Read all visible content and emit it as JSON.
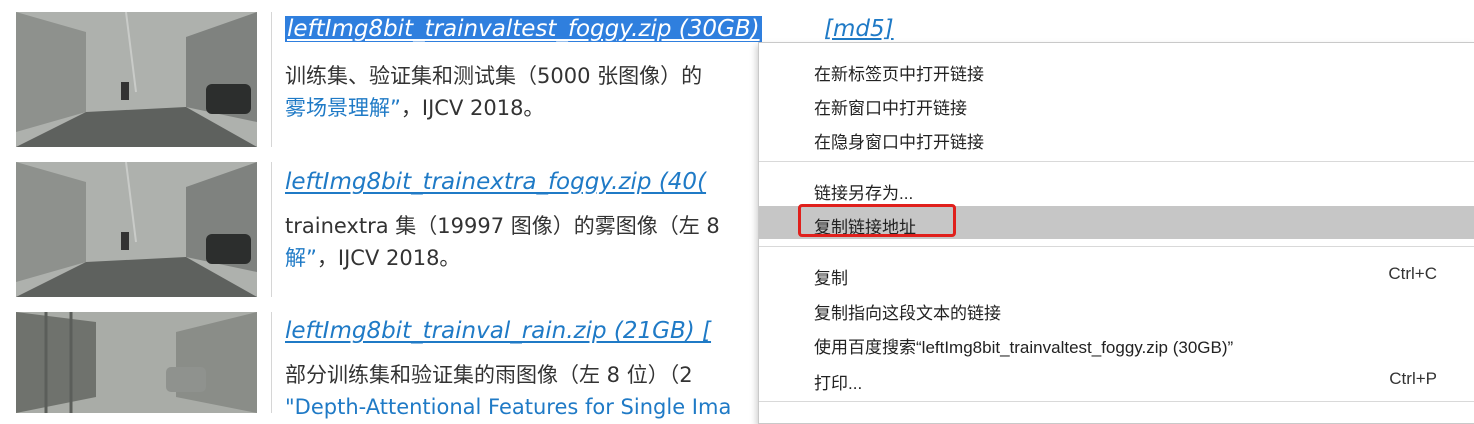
{
  "rows": [
    {
      "title": "leftImg8bit_trainvaltest_foggy.zip (30GB)",
      "md5": "[md5]",
      "desc_line1": "训练集、验证集和测试集（5000 张图像）的",
      "desc_line2_link": "雾场景理解”",
      "desc_line2_rest": "，IJCV 2018。"
    },
    {
      "title": "leftImg8bit_trainextra_foggy.zip (40(",
      "desc_line1": "trainextra 集（19997 图像）的雾图像（左 8",
      "desc_line2_link": "解”",
      "desc_line2_rest": "，IJCV 2018。"
    },
    {
      "title": "leftImg8bit_trainval_rain.zip (21GB) [",
      "desc_line1": "部分训练集和验证集的雨图像（左 8 位）（2",
      "desc_line2_link": "\"Depth-Attentional Features for Single Ima"
    }
  ],
  "context_menu": {
    "items": [
      {
        "label": "在新标签页中打开链接"
      },
      {
        "label": "在新窗口中打开链接"
      },
      {
        "label": "在隐身窗口中打开链接"
      },
      {
        "label": "链接另存为..."
      },
      {
        "label": "复制链接地址"
      },
      {
        "label": "复制",
        "shortcut": "Ctrl+C"
      },
      {
        "label": "复制指向这段文本的链接"
      },
      {
        "label": "使用百度搜索“leftImg8bit_trainvaltest_foggy.zip (30GB)”"
      },
      {
        "label": "打印...",
        "shortcut": "Ctrl+P"
      }
    ]
  },
  "colors": {
    "link": "#1f7ac6",
    "selection": "#2f7fde",
    "highlight_box": "#e0201c",
    "menu_hover": "#c6c6c6"
  }
}
